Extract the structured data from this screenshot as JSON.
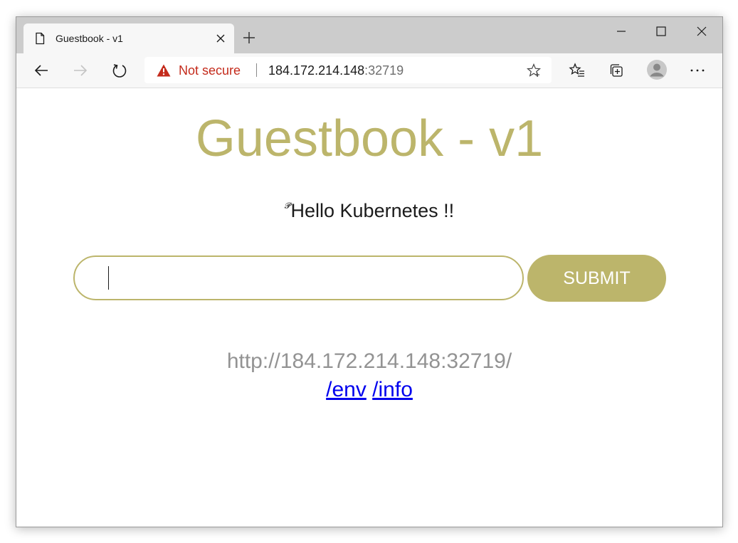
{
  "browser": {
    "tab": {
      "title": "Guestbook - v1",
      "icon": "page-icon"
    },
    "address_bar": {
      "security_label": "Not secure",
      "url_host": "184.172.214.148",
      "url_port": ":32719"
    },
    "icons": {
      "back": "back-arrow-icon",
      "forward": "forward-arrow-icon",
      "refresh": "refresh-icon",
      "favorite": "star-icon",
      "favorites_list": "favorites-icon",
      "collections": "collections-icon",
      "profile": "profile-avatar-icon",
      "menu": "more-icon"
    },
    "colors": {
      "warning": "#c42b1c",
      "tabstrip": "#cccccc",
      "toolbar": "#f7f7f7"
    }
  },
  "page": {
    "title": "Guestbook - v1",
    "greeting_prefix": "𝓟",
    "greeting": "Hello Kubernetes !!",
    "input": {
      "value": "",
      "placeholder": ""
    },
    "submit_label": "SUBMIT",
    "host_url": "http://184.172.214.148:32719/",
    "links": [
      {
        "label": "/env"
      },
      {
        "label": "/info"
      }
    ],
    "colors": {
      "accent": "#bcb56b",
      "link": "#0000ee",
      "muted": "#939393"
    }
  }
}
